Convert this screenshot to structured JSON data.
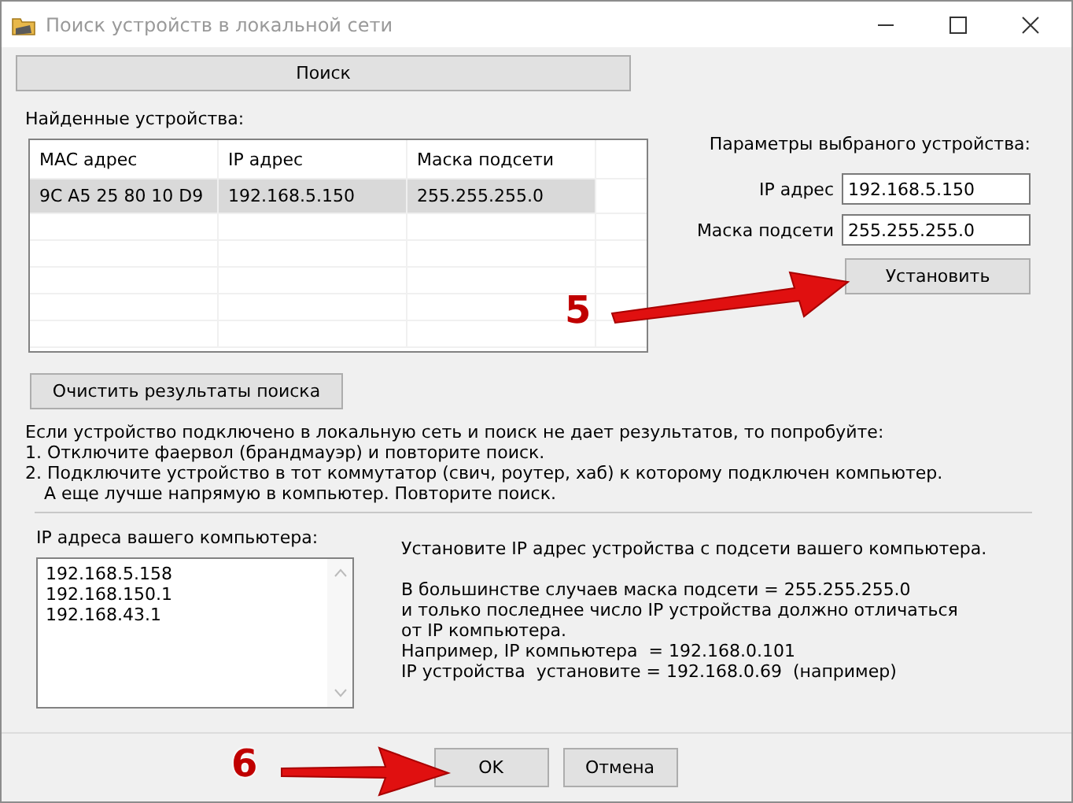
{
  "window": {
    "title": "Поиск устройств в локальной сети"
  },
  "search_button": "Поиск",
  "found_label": "Найденные устройства:",
  "table": {
    "columns": [
      "MAC адрес",
      "IP адрес",
      "Маска подсети"
    ],
    "rows": [
      {
        "cells": [
          "9C A5 25 80 10 D9",
          "192.168.5.150",
          "255.255.255.0"
        ],
        "selected": true
      }
    ]
  },
  "clear_button": "Очистить результаты поиска",
  "params": {
    "title": "Параметры выбраного устройства:",
    "fields": [
      {
        "label": "IP адрес",
        "value": "192.168.5.150"
      },
      {
        "label": "Маска подсети",
        "value": "255.255.255.0"
      }
    ],
    "button": "Установить"
  },
  "instructions": [
    "Если устройство подключено в локальную сеть и поиск не дает результатов, то попробуйте:",
    "1. Отключите фаервол (брандмауэр) и повторите поиск.",
    "2. Подключите устройство в тот коммутатор (свич, роутер, хаб) к которому подключен компьютер.",
    "А еще лучше напрямую в компьютер. Повторите поиск."
  ],
  "computer_ips": {
    "label": "IP адреса вашего компьютера:",
    "items": [
      "192.168.5.158",
      "192.168.150.1",
      "192.168.43.1"
    ]
  },
  "hint": [
    [
      "Установите IP адрес устройства с подсети вашего компьютера."
    ],
    [
      "В большинстве случаев маска подсети = 255.255.255.0",
      "и только последнее число IP устройства должно отличаться",
      "от IP компьютера.",
      "Например, IP компьютера  = 192.168.0.101",
      "IP устройства  установите = 192.168.0.69  (например)"
    ]
  ],
  "buttons": [
    "OK",
    "Отмена"
  ],
  "annotations": [
    {
      "label": "5"
    },
    {
      "label": "6"
    }
  ]
}
